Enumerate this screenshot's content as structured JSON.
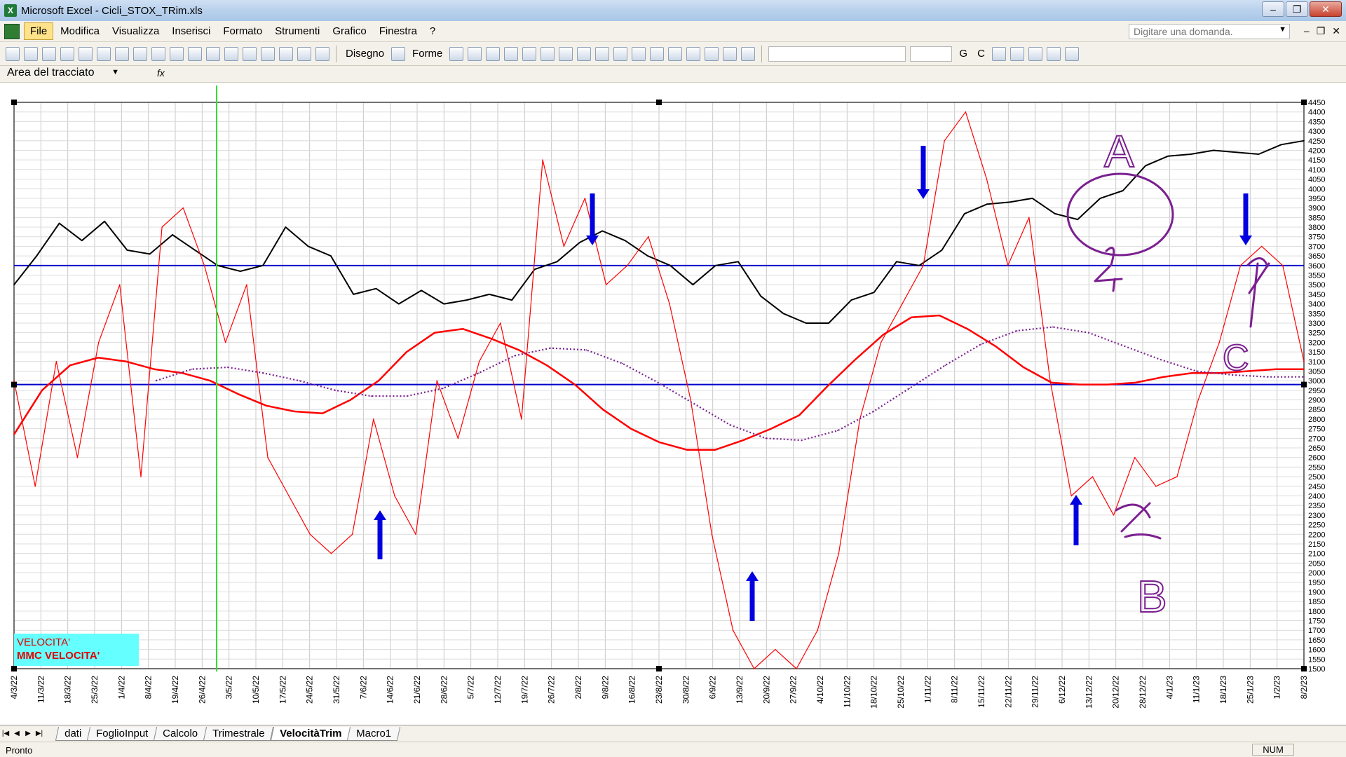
{
  "window": {
    "title": "Microsoft Excel - Cicli_STOX_TRim.xls"
  },
  "menu": {
    "items": [
      "File",
      "Modifica",
      "Visualizza",
      "Inserisci",
      "Formato",
      "Strumenti",
      "Grafico",
      "Finestra",
      "?"
    ]
  },
  "help": {
    "placeholder": "Digitare una domanda."
  },
  "toolbar": {
    "draw_label": "Disegno",
    "shapes_label": "Forme",
    "bold": "G",
    "italic": "C"
  },
  "namebox": {
    "value": "Area del tracciato",
    "fx": "fx"
  },
  "chart_data": {
    "type": "line",
    "ylim": [
      1500,
      4450
    ],
    "yticks": [
      "4450",
      "4400",
      "4350",
      "4300",
      "4250",
      "4200",
      "4150",
      "4100",
      "4050",
      "4000",
      "3950",
      "3900",
      "3850",
      "3800",
      "3750",
      "3700",
      "3650",
      "3600",
      "3550",
      "3500",
      "3450",
      "3400",
      "3350",
      "3300",
      "3250",
      "3200",
      "3150",
      "3100",
      "3050",
      "3000",
      "2950",
      "2900",
      "2850",
      "2800",
      "2750",
      "2700",
      "2650",
      "2600",
      "2550",
      "2500",
      "2450",
      "2400",
      "2350",
      "2300",
      "2250",
      "2200",
      "2150",
      "2100",
      "2050",
      "2000",
      "1950",
      "1900",
      "1850",
      "1800",
      "1750",
      "1700",
      "1650",
      "1600",
      "1550",
      "1500"
    ],
    "xticks": [
      "4/3/22",
      "11/3/22",
      "18/3/22",
      "25/3/22",
      "1/4/22",
      "8/4/22",
      "19/4/22",
      "26/4/22",
      "3/5/22",
      "10/5/22",
      "17/5/22",
      "24/5/22",
      "31/5/22",
      "7/6/22",
      "14/6/22",
      "21/6/22",
      "28/6/22",
      "5/7/22",
      "12/7/22",
      "19/7/22",
      "26/7/22",
      "2/8/22",
      "9/8/22",
      "16/8/22",
      "23/8/22",
      "30/8/22",
      "6/9/22",
      "13/9/22",
      "20/9/22",
      "27/9/22",
      "4/10/22",
      "11/10/22",
      "18/10/22",
      "25/10/22",
      "1/11/22",
      "8/11/22",
      "15/11/22",
      "22/11/22",
      "29/11/22",
      "6/12/22",
      "13/12/22",
      "20/12/22",
      "28/12/22",
      "4/1/23",
      "11/1/23",
      "18/1/23",
      "25/1/23",
      "1/2/23",
      "8/2/23"
    ],
    "hlines": [
      3600,
      2980
    ],
    "series": [
      {
        "name": "",
        "color": "#000000",
        "values": [
          3500,
          3650,
          3820,
          3730,
          3830,
          3680,
          3660,
          3760,
          3680,
          3600,
          3570,
          3600,
          3800,
          3700,
          3650,
          3450,
          3480,
          3400,
          3470,
          3400,
          3420,
          3450,
          3420,
          3580,
          3620,
          3720,
          3780,
          3730,
          3650,
          3600,
          3500,
          3600,
          3620,
          3440,
          3350,
          3300,
          3300,
          3420,
          3460,
          3620,
          3600,
          3680,
          3870,
          3920,
          3930,
          3950,
          3870,
          3840,
          3950,
          3990,
          4120,
          4170,
          4180,
          4200,
          4190,
          4180,
          4230,
          4250
        ]
      },
      {
        "name": "VELOCITA'",
        "color": "#ff0000",
        "values": [
          3000,
          2450,
          3100,
          2600,
          3200,
          3500,
          2500,
          3800,
          3900,
          3600,
          3200,
          3500,
          2600,
          2400,
          2200,
          2100,
          2200,
          2800,
          2400,
          2200,
          3000,
          2700,
          3100,
          3300,
          2800,
          4150,
          3700,
          3950,
          3500,
          3600,
          3750,
          3400,
          2900,
          2200,
          1700,
          1500,
          1600,
          1500,
          1700,
          2100,
          2800,
          3200,
          3400,
          3600,
          4250,
          4400,
          4050,
          3600,
          3850,
          3000,
          2400,
          2500,
          2300,
          2600,
          2450,
          2500,
          2900,
          3200,
          3600,
          3700,
          3600,
          3100
        ]
      },
      {
        "name": "MMC VELOCITA'",
        "color": "#ff0000",
        "values": [
          2720,
          2950,
          3080,
          3120,
          3100,
          3060,
          3040,
          3000,
          2930,
          2870,
          2840,
          2830,
          2900,
          3000,
          3150,
          3250,
          3270,
          3220,
          3160,
          3080,
          2980,
          2850,
          2750,
          2680,
          2640,
          2640,
          2690,
          2750,
          2820,
          2970,
          3110,
          3240,
          3330,
          3340,
          3270,
          3180,
          3070,
          2990,
          2980,
          2980,
          2990,
          3020,
          3040,
          3040,
          3050,
          3060,
          3060
        ]
      },
      {
        "name": "",
        "color": "#7b2090",
        "dashed": true,
        "values": [
          3000,
          3060,
          3070,
          3040,
          3000,
          2950,
          2920,
          2920,
          2960,
          3040,
          3130,
          3170,
          3160,
          3090,
          2990,
          2880,
          2770,
          2700,
          2690,
          2740,
          2840,
          2960,
          3080,
          3190,
          3260,
          3280,
          3250,
          3180,
          3110,
          3050,
          3030,
          3020,
          3020
        ]
      }
    ]
  },
  "legend": {
    "l1": "VELOCITA'",
    "l2": "MMC VELOCITA'"
  },
  "annotations": {
    "a": "A",
    "b": "B",
    "c": "C"
  },
  "sheets": [
    "dati",
    "FoglioInput",
    "Calcolo",
    "Trimestrale",
    "VelocitàTrim",
    "Macro1"
  ],
  "active_sheet": "VelocitàTrim",
  "status": {
    "text": "Pronto",
    "num": "NUM"
  }
}
